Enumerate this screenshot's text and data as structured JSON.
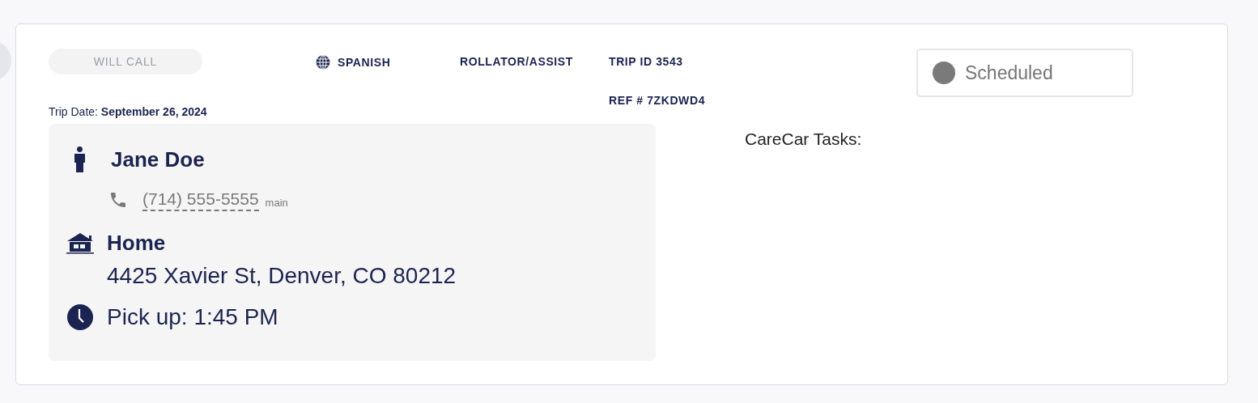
{
  "trip": {
    "will_call": {
      "label": "WILL CALL",
      "disabled": true
    },
    "language": "SPANISH",
    "mobility": "ROLLATOR/ASSIST",
    "trip_id": "TRIP ID 3543",
    "ref": "REF # 7ZKDWD4",
    "status": {
      "label": "Scheduled",
      "color": "#7a7a7a"
    },
    "trip_date_label": "Trip Date:",
    "trip_date": "September 26, 2024",
    "rider": {
      "name": "Jane Doe",
      "phone": "(714) 555-5555",
      "phone_type": "main"
    },
    "location": {
      "name": "Home",
      "address": "4425 Xavier St, Denver, CO 80212"
    },
    "pickup": "Pick up: 1:45 PM",
    "tasks_title": "CareCar Tasks:"
  }
}
